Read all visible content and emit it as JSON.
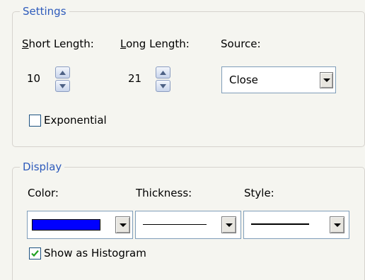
{
  "settings": {
    "title": "Settings",
    "short_length": {
      "label_first": "S",
      "label_rest": "hort Length:",
      "value": "10"
    },
    "long_length": {
      "label_first": "L",
      "label_rest": "ong Length:",
      "value": "21"
    },
    "source": {
      "label": "Source:",
      "value": "Close"
    },
    "exponential": {
      "label": "Exponential",
      "checked": false
    }
  },
  "display": {
    "title": "Display",
    "color": {
      "label": "Color:",
      "value": "#0000ff"
    },
    "thickness": {
      "label": "Thickness:"
    },
    "style": {
      "label": "Style:"
    },
    "histogram": {
      "label": "Show as Histogram",
      "checked": true
    }
  }
}
